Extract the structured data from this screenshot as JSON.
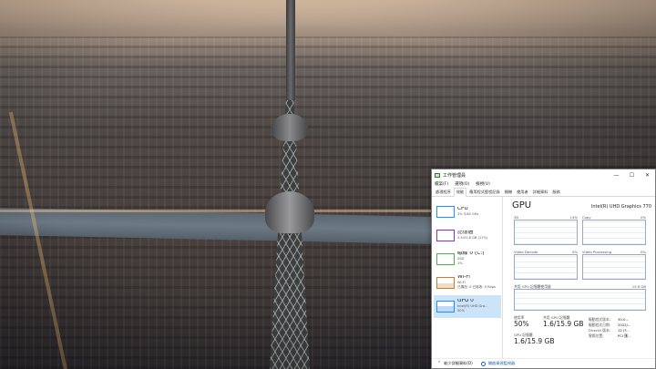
{
  "window": {
    "title": "工作管理員",
    "controls": {
      "minimize": "—",
      "maximize": "☐",
      "close": "✕"
    }
  },
  "menu": [
    "檔案(F)",
    "選項(O)",
    "檢視(V)"
  ],
  "tabs": [
    {
      "label": "處理程序",
      "active": false
    },
    {
      "label": "效能",
      "active": true
    },
    {
      "label": "應用程式歷程記錄",
      "active": false
    },
    {
      "label": "開機",
      "active": false
    },
    {
      "label": "使用者",
      "active": false
    },
    {
      "label": "詳細資料",
      "active": false
    },
    {
      "label": "服務",
      "active": false
    }
  ],
  "sidebar": {
    "items": [
      {
        "name": "CPU",
        "detail": "3%  3.84 GHz",
        "color": "#1e90ff",
        "selected": false
      },
      {
        "name": "記憶體",
        "detail": "5.5/31.8 GB (17%)",
        "color": "#8b2fc9",
        "selected": false
      },
      {
        "name": "磁碟 0 (C:)",
        "detail": "SSD",
        "detail2": "1%",
        "color": "#4caf50",
        "selected": false
      },
      {
        "name": "Wi-Fi",
        "detail": "Wi-Fi",
        "detail2": "已傳送: 0 已接收: 0 Kbps",
        "color": "#c77d2e",
        "selected": false
      },
      {
        "name": "GPU 0",
        "detail": "Intel(R) UHD Gra...",
        "detail2": "50%",
        "color": "#1e90ff",
        "selected": true
      }
    ]
  },
  "gpu": {
    "title": "GPU",
    "model": "Intel(R) UHD Graphics 770",
    "engines": [
      {
        "name": "3D",
        "percent": "14%"
      },
      {
        "name": "Copy",
        "percent": "0%"
      },
      {
        "name": "Video Decode",
        "percent": "0%"
      },
      {
        "name": "Video Processing",
        "percent": "0%"
      }
    ],
    "shared_memory": {
      "label": "共用 GPU 記憶體使用量",
      "max": "15.9 GB"
    },
    "stats": {
      "utilization_label": "使用率",
      "utilization_value": "50%",
      "shared_mem_label": "共用 GPU 記憶體",
      "shared_mem_value": "1.6/15.9 GB",
      "gpu_mem_label": "GPU 記憶體",
      "gpu_mem_value": "1.6/15.9 GB"
    },
    "properties": [
      {
        "key": "驅動程式版本:",
        "value": "30.0..."
      },
      {
        "key": "驅動程式日期:",
        "value": "2022/..."
      },
      {
        "key": "DirectX 版本:",
        "value": "12 (F..."
      },
      {
        "key": "實際位置:",
        "value": "PCI 匯..."
      }
    ]
  },
  "footer": {
    "fewer_details": "較少詳細資料(D)",
    "resource_monitor": "開啟資源監視器"
  }
}
